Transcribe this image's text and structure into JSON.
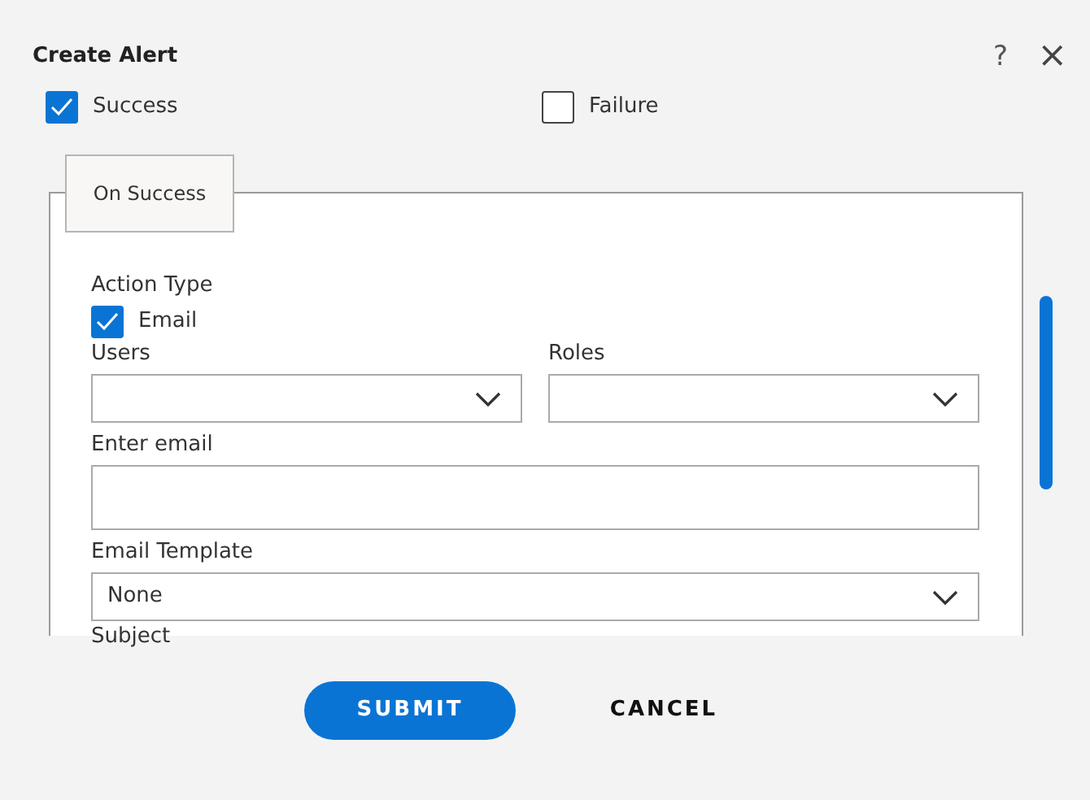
{
  "window": {
    "title": "Create Alert",
    "help": "?",
    "close": "×"
  },
  "triggers": [
    {
      "label": "Success",
      "checked": true
    },
    {
      "label": "Failure",
      "checked": false
    }
  ],
  "tab": {
    "label": "On Success"
  },
  "form": {
    "action_type_label": "Action Type",
    "action_types": [
      {
        "label": "Email",
        "checked": true
      }
    ],
    "users": {
      "label": "Users"
    },
    "roles": {
      "label": "Roles"
    },
    "email": {
      "label": "Enter email"
    },
    "template": {
      "label": "Email Template",
      "value": "None"
    },
    "subject": {
      "label": "Subject"
    }
  },
  "buttons": [
    {
      "label": "SUBMIT",
      "kind": "primary"
    },
    {
      "label": "CANCEL",
      "kind": "secondary"
    }
  ]
}
